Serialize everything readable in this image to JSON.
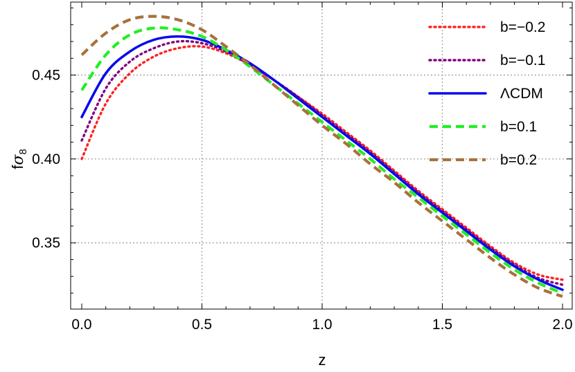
{
  "chart_data": {
    "type": "line",
    "xlabel": "z",
    "ylabel_main": "f",
    "ylabel_symbol": "σ",
    "ylabel_subscript": "8",
    "xlim": [
      0,
      2.0
    ],
    "ylim": [
      0.3105,
      0.4935
    ],
    "grid": true,
    "legend_position": "top-right",
    "x_ticks": [
      0.0,
      0.5,
      1.0,
      1.5,
      2.0
    ],
    "x_tick_labels": [
      "0.0",
      "0.5",
      "1.0",
      "1.5",
      "2.0"
    ],
    "y_ticks": [
      0.35,
      0.4,
      0.45
    ],
    "y_tick_labels": [
      "0.35",
      "0.40",
      "0.45"
    ],
    "x": [
      0.0,
      0.1,
      0.2,
      0.3,
      0.4,
      0.5,
      0.6,
      0.7,
      0.8,
      0.9,
      1.0,
      1.1,
      1.2,
      1.3,
      1.4,
      1.5,
      1.6,
      1.7,
      1.8,
      1.9,
      2.0
    ],
    "series": [
      {
        "name": "b=−0.2",
        "color": "#ff2020",
        "style": "dotted",
        "values": [
          0.4,
          0.433,
          0.451,
          0.461,
          0.466,
          0.467,
          0.463,
          0.456,
          0.447,
          0.437,
          0.427,
          0.416,
          0.405,
          0.393,
          0.381,
          0.37,
          0.359,
          0.348,
          0.338,
          0.331,
          0.328
        ]
      },
      {
        "name": "b=−0.1",
        "color": "#800080",
        "style": "dotted",
        "values": [
          0.411,
          0.442,
          0.458,
          0.466,
          0.47,
          0.469,
          0.464,
          0.456,
          0.447,
          0.437,
          0.426,
          0.415,
          0.404,
          0.392,
          0.38,
          0.369,
          0.358,
          0.347,
          0.337,
          0.329,
          0.325
        ]
      },
      {
        "name": "ΛCDM",
        "color": "#0a0aee",
        "style": "solid",
        "values": [
          0.425,
          0.451,
          0.464,
          0.471,
          0.473,
          0.471,
          0.465,
          0.457,
          0.447,
          0.436,
          0.425,
          0.414,
          0.403,
          0.391,
          0.379,
          0.368,
          0.357,
          0.346,
          0.336,
          0.328,
          0.322
        ]
      },
      {
        "name": "b=0.1",
        "color": "#22ee22",
        "style": "dashed",
        "values": [
          0.441,
          0.462,
          0.474,
          0.478,
          0.477,
          0.473,
          0.465,
          0.455,
          0.444,
          0.433,
          0.422,
          0.411,
          0.4,
          0.388,
          0.377,
          0.366,
          0.355,
          0.344,
          0.334,
          0.326,
          0.32
        ]
      },
      {
        "name": "b=0.2",
        "color": "#a8713c",
        "style": "dashed",
        "values": [
          0.462,
          0.475,
          0.483,
          0.485,
          0.483,
          0.477,
          0.467,
          0.456,
          0.444,
          0.432,
          0.42,
          0.409,
          0.397,
          0.386,
          0.374,
          0.363,
          0.352,
          0.341,
          0.331,
          0.323,
          0.318
        ]
      }
    ]
  }
}
